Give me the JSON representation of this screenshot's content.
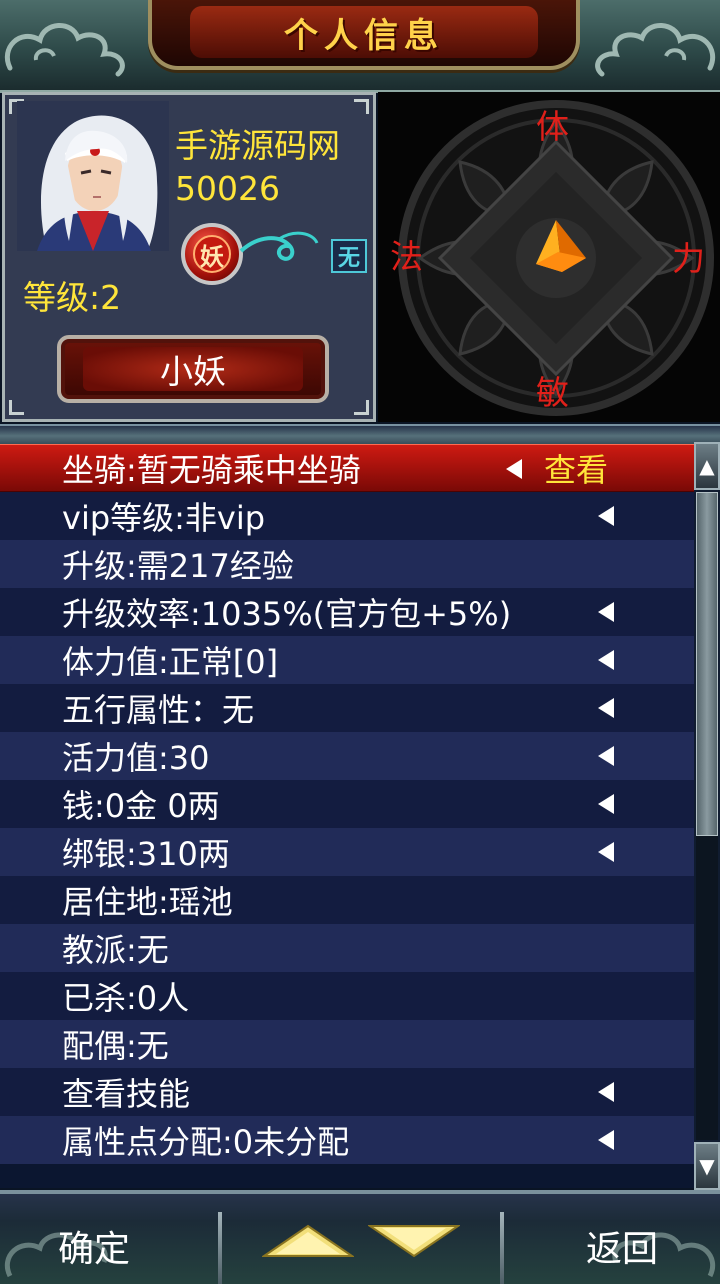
{
  "header": {
    "title": "个人信息"
  },
  "profile": {
    "name": "手游源码网",
    "id": "50026",
    "race_badge": "妖",
    "element_badge": "无",
    "level": "等级:2",
    "class_label": "小妖"
  },
  "compass": {
    "top": "体",
    "left": "法",
    "right": "力",
    "bottom": "敏"
  },
  "list": {
    "rows": [
      {
        "label": "坐骑:暂无骑乘中坐骑",
        "arrow": true,
        "action": "查看",
        "selected": true
      },
      {
        "label": "vip等级:非vip",
        "arrow": true
      },
      {
        "label": "升级:需217经验",
        "arrow": false
      },
      {
        "label": "升级效率:1035%(官方包+5%)",
        "arrow": true
      },
      {
        "label": "体力值:正常[0]",
        "arrow": true
      },
      {
        "label": "五行属性：无",
        "arrow": true
      },
      {
        "label": "活力值:30",
        "arrow": true
      },
      {
        "label": "钱:0金 0两",
        "arrow": true
      },
      {
        "label": "绑银:310两",
        "arrow": true
      },
      {
        "label": "居住地:瑶池",
        "arrow": false
      },
      {
        "label": "教派:无",
        "arrow": false
      },
      {
        "label": "已杀:0人",
        "arrow": false
      },
      {
        "label": "配偶:无",
        "arrow": false
      },
      {
        "label": "查看技能",
        "arrow": true
      },
      {
        "label": "属性点分配:0未分配",
        "arrow": true
      }
    ]
  },
  "bottom": {
    "confirm": "确定",
    "back": "返回"
  },
  "colors": {
    "highlight_text": "#ffe53a",
    "axis_text": "#e0201a",
    "selected_row": "#ce1a12"
  }
}
